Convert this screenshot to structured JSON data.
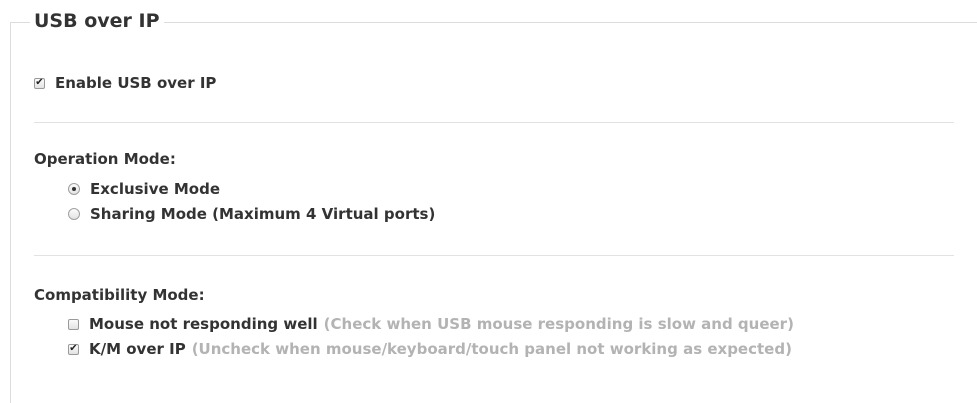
{
  "legend": "USB over IP",
  "enable": {
    "label": "Enable USB over IP",
    "checked": true
  },
  "operation_mode": {
    "label": "Operation Mode:",
    "options": [
      {
        "label": "Exclusive Mode",
        "selected": true
      },
      {
        "label": "Sharing Mode (Maximum 4 Virtual ports)",
        "selected": false
      }
    ]
  },
  "compatibility_mode": {
    "label": "Compatibility Mode:",
    "options": [
      {
        "label": "Mouse not responding well",
        "hint": "(Check when USB mouse responding is slow and queer)",
        "checked": false
      },
      {
        "label": "K/M over IP",
        "hint": "(Uncheck when mouse/keyboard/touch panel not working as expected)",
        "checked": true
      }
    ]
  }
}
